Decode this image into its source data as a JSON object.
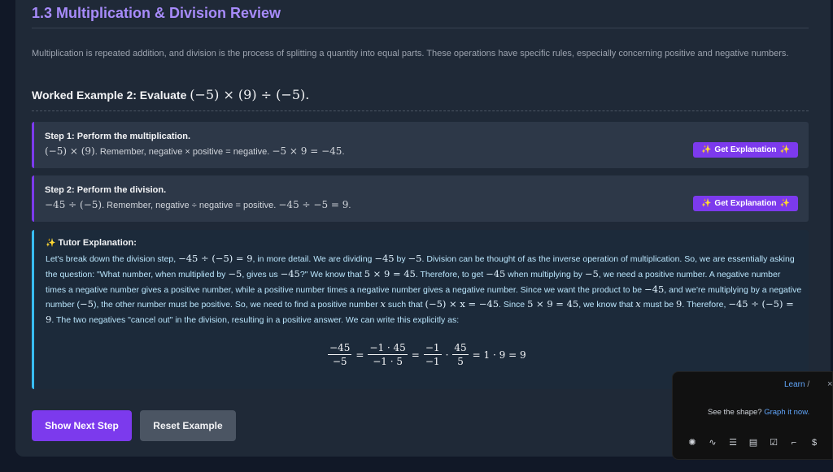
{
  "section": {
    "title": "1.3 Multiplication & Division Review",
    "intro": "Multiplication is repeated addition, and division is the process of splitting a quantity into equal parts. These operations have specific rules, especially concerning positive and negative numbers."
  },
  "example": {
    "label": "Worked Example 2:",
    "verb": "Evaluate",
    "expression": "(−5) × (9) ÷ (−5)."
  },
  "steps": [
    {
      "title": "Step 1: Perform the multiplication.",
      "expr": "(−5) × (9)",
      "text": ". Remember, negative × positive = negative.",
      "result": "−5 × 9 = −45",
      "tail": "."
    },
    {
      "title": "Step 2: Perform the division.",
      "expr": "−45 ÷ (−5)",
      "text": ". Remember, negative ÷ negative = positive.",
      "result": "−45 ÷ −5 = 9",
      "tail": "."
    }
  ],
  "buttons": {
    "get_explanation": "Get Explanation",
    "show_next_step": "Show Next Step",
    "reset_example": "Reset Example"
  },
  "tutor": {
    "title": "Tutor Explanation:",
    "fraction": {
      "n1": "−45",
      "d1": "−5",
      "n2": "−1 · 45",
      "d2": "−1 · 5",
      "n3": "−1",
      "d3": "−1",
      "n4": "45",
      "d4": "5",
      "eq": "=",
      "dot": "·",
      "result": "= 1 · 9 = 9"
    },
    "t": {
      "a1": "Let's break down the division step, ",
      "m1": "−45 ÷ (−5) = 9",
      "a2": ", in more detail. We are dividing ",
      "m2": "−45",
      "a3": " by ",
      "m3": "−5",
      "a4": ". Division can be thought of as the inverse operation of multiplication. So, we are essentially asking the question: \"What number, when multiplied by ",
      "m4": "−5",
      "a5": ", gives us ",
      "m5": "−45",
      "a6": "?\" We know that ",
      "m6": "5 × 9 = 45",
      "a7": ". Therefore, to get ",
      "m7": "−45",
      "a8": " when multiplying by ",
      "m8": "−5",
      "a9": ", we need a positive number. A negative number times a negative number gives a positive number, while a positive number times a negative number gives a negative number. Since we want the product to be ",
      "m9": "−45",
      "a10": ", and we're multiplying by a negative number (",
      "m10": "−5",
      "a11": "), the other number must be positive. So, we need to find a positive number ",
      "m11": "x",
      "a12": " such that ",
      "m12": "(−5) × x = −45",
      "a13": ". Since ",
      "m13": "5 × 9 = 45",
      "a14": ", we know that ",
      "m14": "x",
      "a15": " must be ",
      "m15": "9",
      "a16": ". Therefore, ",
      "m16": "−45 ÷ (−5) = 9",
      "a17": ". The two negatives \"cancel out\" in the division, resulting in a positive answer. We can write this explicitly as:"
    }
  },
  "panel": {
    "learn": "Learn",
    "slash": "/",
    "close": "×",
    "message": "See the shape?",
    "link": "Graph it now."
  },
  "icons": [
    "brain-icon",
    "pulse-icon",
    "list-icon",
    "document-icon",
    "checkbox-icon",
    "frame-icon",
    "dollar-icon"
  ]
}
